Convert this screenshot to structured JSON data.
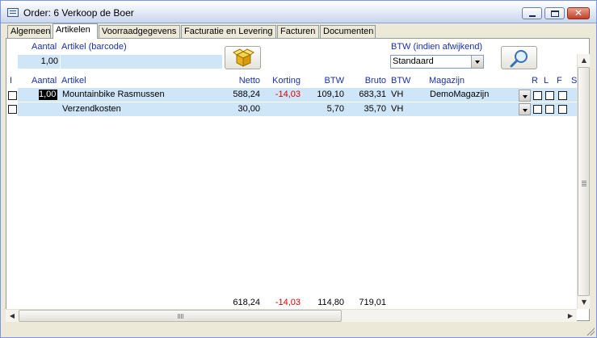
{
  "window": {
    "title": "Order: 6 Verkoop de Boer"
  },
  "tabs": [
    {
      "label": "Algemeen"
    },
    {
      "label": "Artikelen"
    },
    {
      "label": "Voorraadgegevens"
    },
    {
      "label": "Facturatie en Levering"
    },
    {
      "label": "Facturen"
    },
    {
      "label": "Documenten"
    }
  ],
  "active_tab": "Artikelen",
  "entry": {
    "aantal_label": "Aantal",
    "aantal_value": "1,00",
    "artikel_label": "Artikel (barcode)",
    "artikel_value": "",
    "btw_label": "BTW (indien afwijkend)",
    "btw_value": "Standaard"
  },
  "grid": {
    "headers": {
      "i": "I",
      "aantal": "Aantal",
      "artikel": "Artikel",
      "netto": "Netto",
      "korting": "Korting",
      "btw": "BTW",
      "bruto": "Bruto",
      "btw_code": "BTW",
      "magazijn": "Magazijn",
      "r": "R",
      "l": "L",
      "f": "F",
      "s": "S"
    },
    "rows": [
      {
        "aantal": "1,00",
        "artikel": "Mountainbike Rasmussen",
        "netto": "588,24",
        "korting": "-14,03",
        "btw": "109,10",
        "bruto": "683,31",
        "btw_code": "VH",
        "magazijn": "DemoMagazijn"
      },
      {
        "aantal": "",
        "artikel": "Verzendkosten",
        "netto": "30,00",
        "korting": "",
        "btw": "5,70",
        "bruto": "35,70",
        "btw_code": "VH",
        "magazijn": ""
      }
    ],
    "totals": {
      "netto": "618,24",
      "korting": "-14,03",
      "btw": "114,80",
      "bruto": "719,01"
    }
  },
  "colors": {
    "label_blue": "#1a2fa8",
    "negative_red": "#d40000",
    "row_highlight": "#cfe6f8"
  },
  "icons": {
    "add_button": "open-box-icon",
    "search_button": "magnifier-icon"
  }
}
